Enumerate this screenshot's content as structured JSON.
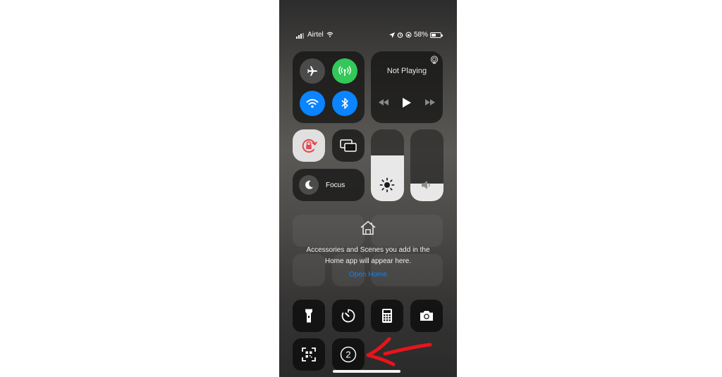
{
  "status_bar": {
    "carrier": "Airtel",
    "battery_percent": "58%",
    "battery_level": 0.58
  },
  "connectivity": {
    "airplane": {
      "icon": "airplane-icon",
      "active": false
    },
    "cellular": {
      "icon": "cellular-antenna-icon",
      "active": true,
      "color": "#34c759"
    },
    "wifi": {
      "icon": "wifi-icon",
      "active": true,
      "color": "#0a84ff"
    },
    "bluetooth": {
      "icon": "bluetooth-icon",
      "active": true,
      "color": "#0a84ff"
    }
  },
  "now_playing": {
    "label": "Not Playing",
    "airplay_icon": "airplay-icon",
    "controls": [
      "rewind-icon",
      "play-icon",
      "fast-forward-icon"
    ]
  },
  "toggles": {
    "rotation_lock": {
      "icon": "rotation-lock-icon",
      "active": true,
      "color": "#e5484d"
    },
    "screen_mirroring": {
      "icon": "screen-mirroring-icon"
    }
  },
  "sliders": {
    "brightness": {
      "icon": "sun-icon",
      "level": 0.64
    },
    "volume": {
      "icon": "speaker-icon",
      "level": 0.25
    }
  },
  "focus": {
    "label": "Focus",
    "icon": "moon-icon"
  },
  "home": {
    "line1": "Accessories and Scenes you add in the",
    "line2": "Home app will appear here.",
    "link": "Open Home",
    "icon": "home-icon"
  },
  "shortcuts": [
    {
      "name": "flashlight",
      "icon": "flashlight-icon"
    },
    {
      "name": "timer",
      "icon": "timer-icon"
    },
    {
      "name": "calculator",
      "icon": "calculator-icon"
    },
    {
      "name": "camera",
      "icon": "camera-icon"
    },
    {
      "name": "code-scanner",
      "icon": "qr-scanner-icon"
    },
    {
      "name": "screen-time-badge",
      "icon": "circled-number-icon",
      "value": "2"
    }
  ],
  "annotation": {
    "icon": "red-arrow-icon",
    "color": "#e8141b"
  }
}
